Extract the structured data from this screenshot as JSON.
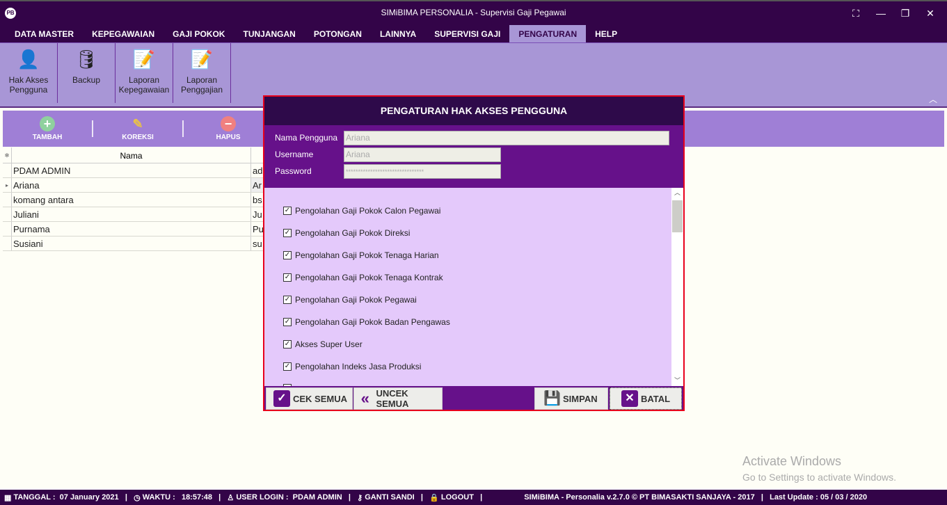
{
  "window": {
    "title": "SIMiBIMA PERSONALIA - Supervisi Gaji Pegawai",
    "logo": "PB"
  },
  "menu": [
    "DATA MASTER",
    "KEPEGAWAIAN",
    "GAJI POKOK",
    "TUNJANGAN",
    "POTONGAN",
    "LAINNYA",
    "SUPERVISI GAJI",
    "PENGATURAN",
    "HELP"
  ],
  "menu_active": "PENGATURAN",
  "ribbon": [
    {
      "label1": "Hak Akses",
      "label2": "Pengguna",
      "icon": "user-key-icon"
    },
    {
      "label1": "Backup",
      "label2": "",
      "icon": "database-clock-icon"
    },
    {
      "label1": "Laporan",
      "label2": "Kepegawaian",
      "icon": "report-edit-icon"
    },
    {
      "label1": "Laporan",
      "label2": "Penggajian",
      "icon": "report-edit-icon"
    }
  ],
  "toolbar": {
    "add": "TAMBAH",
    "edit": "KOREKSI",
    "delete": "HAPUS"
  },
  "grid": {
    "header": "Nama",
    "rows": [
      {
        "nama": "PDAM ADMIN",
        "user": "ad"
      },
      {
        "nama": "Ariana",
        "user": "Ar"
      },
      {
        "nama": "komang antara",
        "user": "bs"
      },
      {
        "nama": "Juliani",
        "user": "Ju"
      },
      {
        "nama": "Purnama",
        "user": "Pu"
      },
      {
        "nama": "Susiani",
        "user": "su"
      }
    ]
  },
  "dialog": {
    "title": "PENGATURAN HAK AKSES PENGGUNA",
    "fields": {
      "nama_label": "Nama Pengguna",
      "nama": "Ariana",
      "username_label": "Username",
      "username": "Ariana",
      "password_label": "Password",
      "password": "********************************"
    },
    "checks": [
      "Pengolahan Gaji Pokok Calon Pegawai",
      "Pengolahan Gaji Pokok Direksi",
      "Pengolahan Gaji Pokok Tenaga Harian",
      "Pengolahan Gaji Pokok Tenaga Kontrak",
      "Pengolahan Gaji Pokok Pegawai",
      "Pengolahan Gaji Pokok Badan Pengawas",
      "Akses Super User",
      "Pengolahan Indeks Jasa Produksi"
    ],
    "buttons": {
      "check_all": "CEK SEMUA",
      "uncheck_all": "UNCEK SEMUA",
      "save": "SIMPAN",
      "cancel": "BATAL"
    }
  },
  "status": {
    "date": "TANGGAL :  07 January 2021   |",
    "time": "WAKTU :   18:57:48   |",
    "user": "USER LOGIN :  PDAM ADMIN   |",
    "pass": "GANTI SANDI   |",
    "logout": "LOGOUT   |",
    "version": "SIMiBIMA - Personalia v.2.7.0 © PT BIMASAKTI SANJAYA - 2017   |   Last Update : 05 / 03 / 2020"
  },
  "watermark": {
    "line1": "Activate Windows",
    "line2": "Go to Settings to activate Windows."
  },
  "colors": {
    "titlebar": "#330448",
    "ribbon": "#a896d6",
    "toolbar": "#9f7fd6",
    "dialog": "#66118a",
    "checklist": "#e4c9fb",
    "border": "#e8001c"
  }
}
